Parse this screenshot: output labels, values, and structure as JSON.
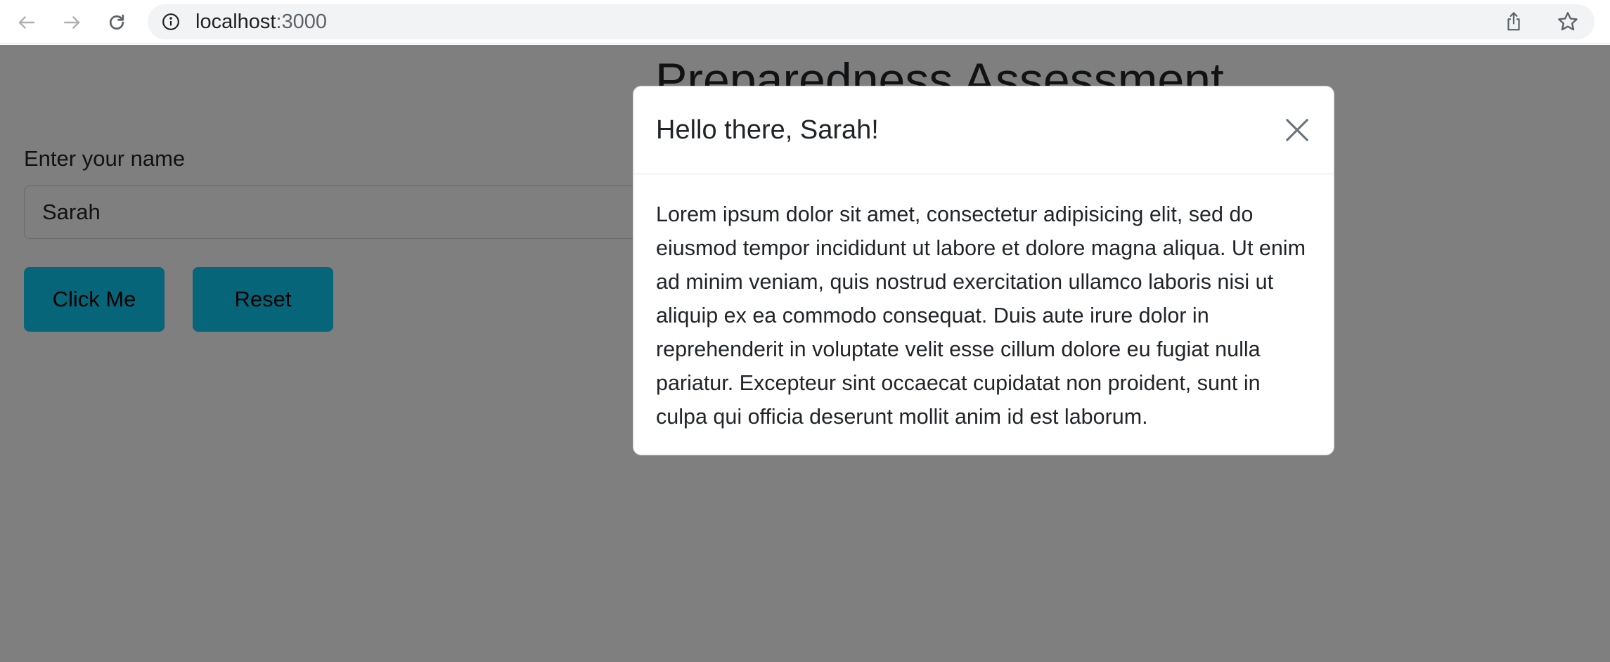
{
  "browser": {
    "url_host": "localhost",
    "url_port": ":3000",
    "icons": {
      "back": "arrow-left-icon",
      "forward": "arrow-right-icon",
      "reload": "reload-icon",
      "site_info": "info-circle-icon",
      "share": "share-icon",
      "bookmark": "star-icon"
    }
  },
  "page": {
    "title": "Preparedness Assessment",
    "name_label": "Enter your name",
    "name_value": "Sarah",
    "buttons": {
      "click_me": "Click Me",
      "reset": "Reset"
    },
    "button_color": "#0dcaf0"
  },
  "modal": {
    "title": "Hello there, Sarah!",
    "body": "Lorem ipsum dolor sit amet, consectetur adipisicing elit, sed do eiusmod tempor incididunt ut labore et dolore magna aliqua. Ut enim ad minim veniam, quis nostrud exercitation ullamco laboris nisi ut aliquip ex ea commodo consequat. Duis aute irure dolor in reprehenderit in voluptate velit esse cillum dolore eu fugiat nulla pariatur. Excepteur sint occaecat cupidatat non proident, sunt in culpa qui officia deserunt mollit anim id est laborum.",
    "close_icon": "close-icon"
  }
}
